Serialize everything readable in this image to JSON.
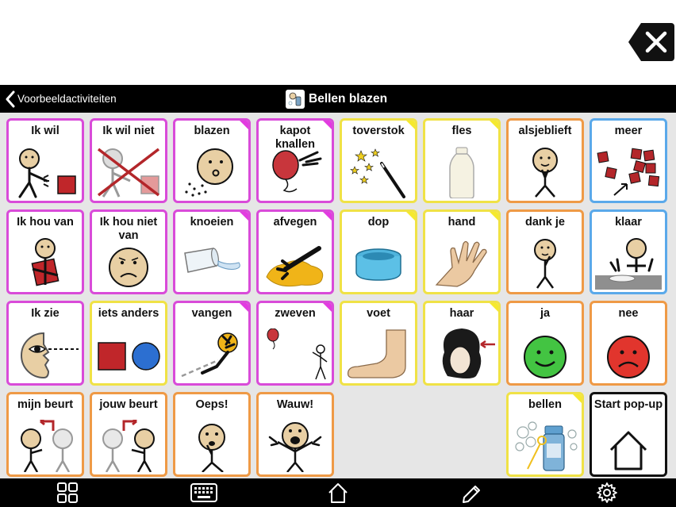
{
  "nav": {
    "back_label": "Voorbeeldactiviteiten",
    "title": "Bellen blazen"
  },
  "colors": {
    "magenta": "#d94bd9",
    "yellow": "#f0e246",
    "orange": "#ef9a46",
    "blue": "#5aa9ea",
    "black": "#111111"
  },
  "cells": [
    {
      "label": "Ik wil",
      "color": "magenta",
      "icon": "i-want-icon"
    },
    {
      "label": "Ik wil niet",
      "color": "magenta",
      "icon": "i-do-not-want-icon"
    },
    {
      "label": "blazen",
      "color": "magenta",
      "icon": "blow-icon"
    },
    {
      "label": "kapot knallen",
      "color": "magenta",
      "icon": "pop-balloon-icon"
    },
    {
      "label": "toverstok",
      "color": "yellow",
      "icon": "magic-wand-icon"
    },
    {
      "label": "fles",
      "color": "yellow",
      "icon": "bottle-icon"
    },
    {
      "label": "alsjeblieft",
      "color": "orange",
      "icon": "please-icon"
    },
    {
      "label": "meer",
      "color": "blue",
      "icon": "more-icon"
    },
    {
      "label": "Ik hou van",
      "color": "magenta",
      "icon": "i-like-icon"
    },
    {
      "label": "Ik hou niet van",
      "color": "magenta",
      "icon": "i-dislike-icon"
    },
    {
      "label": "knoeien",
      "color": "magenta",
      "icon": "spill-icon"
    },
    {
      "label": "afvegen",
      "color": "magenta",
      "icon": "wipe-icon"
    },
    {
      "label": "dop",
      "color": "yellow",
      "icon": "cap-icon"
    },
    {
      "label": "hand",
      "color": "yellow",
      "icon": "hand-icon"
    },
    {
      "label": "dank je",
      "color": "orange",
      "icon": "thank-you-icon"
    },
    {
      "label": "klaar",
      "color": "blue",
      "icon": "finished-icon"
    },
    {
      "label": "Ik zie",
      "color": "magenta",
      "icon": "i-see-icon"
    },
    {
      "label": "iets anders",
      "color": "yellow",
      "icon": "something-else-icon"
    },
    {
      "label": "vangen",
      "color": "magenta",
      "icon": "catch-icon"
    },
    {
      "label": "zweven",
      "color": "magenta",
      "icon": "float-icon"
    },
    {
      "label": "voet",
      "color": "yellow",
      "icon": "foot-icon"
    },
    {
      "label": "haar",
      "color": "yellow",
      "icon": "hair-icon"
    },
    {
      "label": "ja",
      "color": "orange",
      "icon": "yes-icon"
    },
    {
      "label": "nee",
      "color": "orange",
      "icon": "no-icon"
    },
    {
      "label": "mijn beurt",
      "color": "orange",
      "icon": "my-turn-icon"
    },
    {
      "label": "jouw beurt",
      "color": "orange",
      "icon": "your-turn-icon"
    },
    {
      "label": "Oeps!",
      "color": "orange",
      "icon": "oops-icon"
    },
    {
      "label": "Wauw!",
      "color": "orange",
      "icon": "wow-icon"
    },
    {
      "label": "bellen",
      "color": "yellow",
      "icon": "bubbles-icon"
    },
    {
      "label": "Start pop-up",
      "color": "black",
      "icon": "home-icon"
    }
  ],
  "toolbar": [
    "grid-icon",
    "keyboard-icon",
    "home-icon",
    "pencil-icon",
    "gear-icon"
  ]
}
